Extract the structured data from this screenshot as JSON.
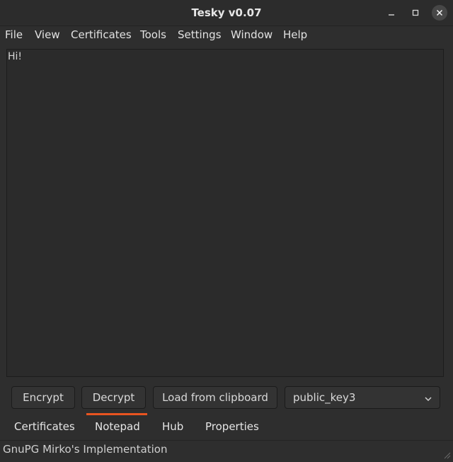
{
  "window": {
    "title": "Tesky v0.07",
    "minimize_icon": "minimize-icon",
    "maximize_icon": "maximize-icon",
    "close_icon": "close-icon"
  },
  "menubar": {
    "items": [
      "File",
      "View",
      "Certificates",
      "Tools",
      "Settings",
      "Window",
      "Help"
    ]
  },
  "editor": {
    "content": "Hi!"
  },
  "actions": {
    "encrypt_label": "Encrypt",
    "decrypt_label": "Decrypt",
    "load_label": "Load from clipboard",
    "key_select": {
      "value": "public_key3",
      "icon": "chevron-down-icon"
    }
  },
  "tabs": {
    "items": [
      "Certificates",
      "Notepad",
      "Hub",
      "Properties"
    ],
    "active": "Notepad",
    "active_color": "#e95420"
  },
  "statusbar": {
    "text": "GnuPG Mirko's Implementation",
    "grip_icon": "size-grip-icon"
  }
}
